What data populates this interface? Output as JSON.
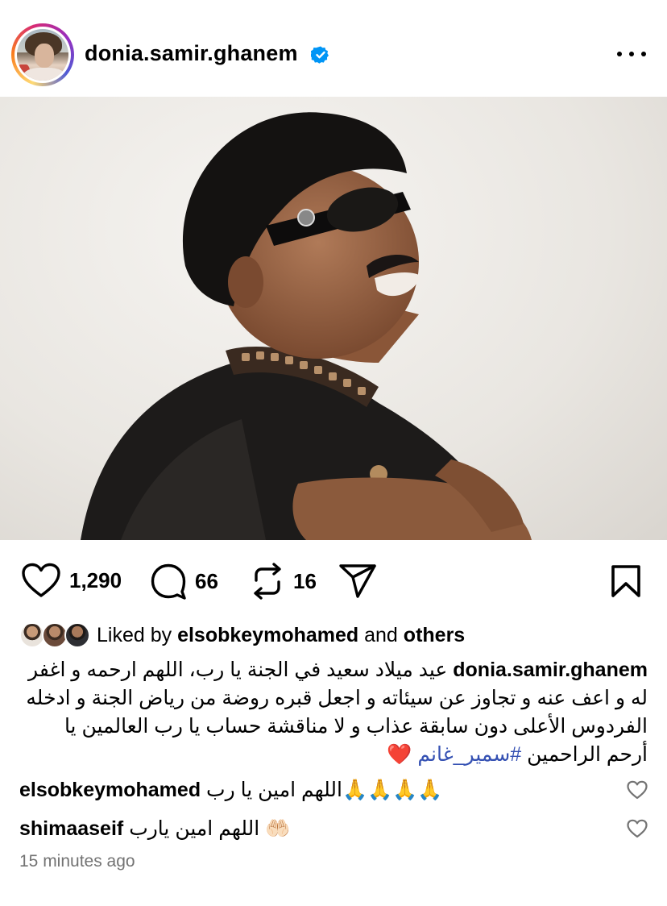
{
  "post": {
    "username": "donia.samir.ghanem",
    "verified": true,
    "avatar_icon": "profile-avatar",
    "more_icon": "more-horizontal-icon"
  },
  "actions": {
    "likes_count": "1,290",
    "comments_count": "66",
    "reposts_count": "16"
  },
  "likes": {
    "prefix": "Liked by",
    "user": "elsobkeymohamed",
    "joiner": "and",
    "others": "others"
  },
  "caption": {
    "user": "donia.samir.ghanem",
    "text": "عيد ميلاد سعيد في الجنة يا رب، اللهم ارحمه و اغفر له و اعف عنه و تجاوز عن سيئاته و اجعل قبره روضة من رياض الجنة و ادخله الفردوس الأعلى دون سابقة عذاب و لا مناقشة حساب يا رب العالمين يا أرحم الراحمين",
    "hashtag": "#سمير_غانم",
    "emoji": "❤️"
  },
  "comments": [
    {
      "user": "elsobkeymohamed",
      "text": "اللهم امين يا رب",
      "emoji": "🙏🙏🙏🙏"
    },
    {
      "user": "shimaaseif",
      "text": "اللهم امين يارب",
      "emoji": "🤲🏻"
    }
  ],
  "timestamp": "15 minutes ago",
  "colors": {
    "verified_blue": "#0095f6",
    "hashtag": "#3551b3",
    "secondary_text": "#737373"
  }
}
